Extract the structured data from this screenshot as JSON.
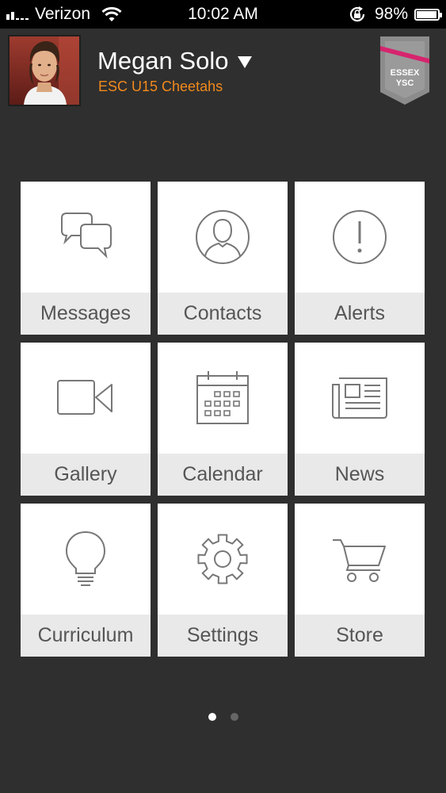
{
  "status_bar": {
    "carrier": "Verizon",
    "time": "10:02 AM",
    "battery_percent": "98%",
    "battery_level": 0.98,
    "signal_bars": 2
  },
  "header": {
    "user_name": "Megan Solo",
    "team_name": "ESC U15 Cheetahs",
    "team_color": "#f28a1c",
    "badge": {
      "line1": "ESSEX",
      "line2": "YSC",
      "accent_color": "#d6246e"
    }
  },
  "tiles": [
    {
      "label": "Messages",
      "icon": "messages-icon"
    },
    {
      "label": "Contacts",
      "icon": "contacts-icon"
    },
    {
      "label": "Alerts",
      "icon": "alerts-icon"
    },
    {
      "label": "Gallery",
      "icon": "gallery-icon"
    },
    {
      "label": "Calendar",
      "icon": "calendar-icon"
    },
    {
      "label": "News",
      "icon": "news-icon"
    },
    {
      "label": "Curriculum",
      "icon": "curriculum-icon"
    },
    {
      "label": "Settings",
      "icon": "settings-icon"
    },
    {
      "label": "Store",
      "icon": "store-icon"
    }
  ],
  "pagination": {
    "total_pages": 2,
    "current_page": 1
  }
}
